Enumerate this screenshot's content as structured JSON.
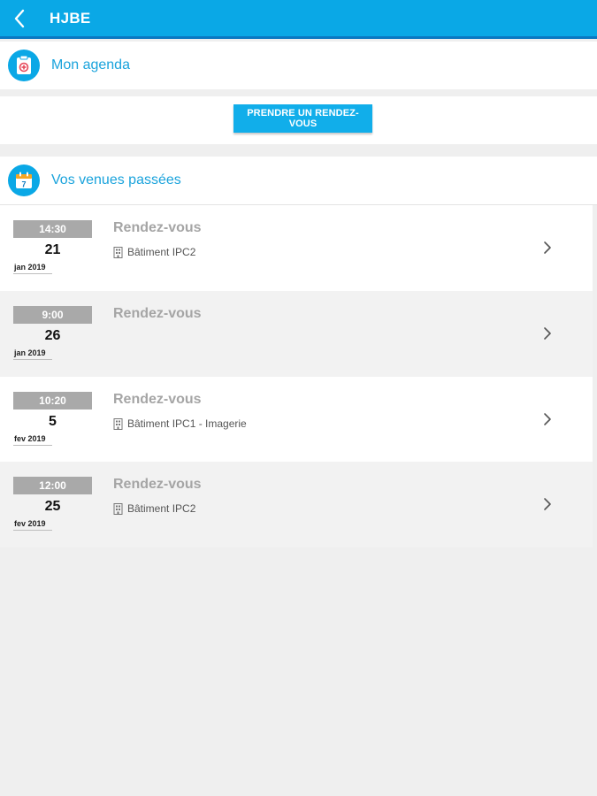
{
  "header": {
    "title": "HJBE",
    "back_icon": "chevron-left-icon",
    "bg_color": "#0aa8e6"
  },
  "agenda": {
    "title": "Mon agenda",
    "icon": "medical-clipboard-icon"
  },
  "cta": {
    "label": "PRENDRE UN RENDEZ-VOUS"
  },
  "past_visits": {
    "title": "Vos venues passées",
    "icon": "calendar-7-icon",
    "calendar_day": "7",
    "items": [
      {
        "time": "14:30",
        "day": "21",
        "month_year": "jan 2019",
        "title": "Rendez-vous",
        "location": "Bâtiment IPC2"
      },
      {
        "time": "9:00",
        "day": "26",
        "month_year": "jan 2019",
        "title": "Rendez-vous",
        "location": ""
      },
      {
        "time": "10:20",
        "day": "5",
        "month_year": "fev 2019",
        "title": "Rendez-vous",
        "location": "Bâtiment IPC1 - Imagerie"
      },
      {
        "time": "12:00",
        "day": "25",
        "month_year": "fev 2019",
        "title": "Rendez-vous",
        "location": "Bâtiment IPC2"
      }
    ]
  }
}
